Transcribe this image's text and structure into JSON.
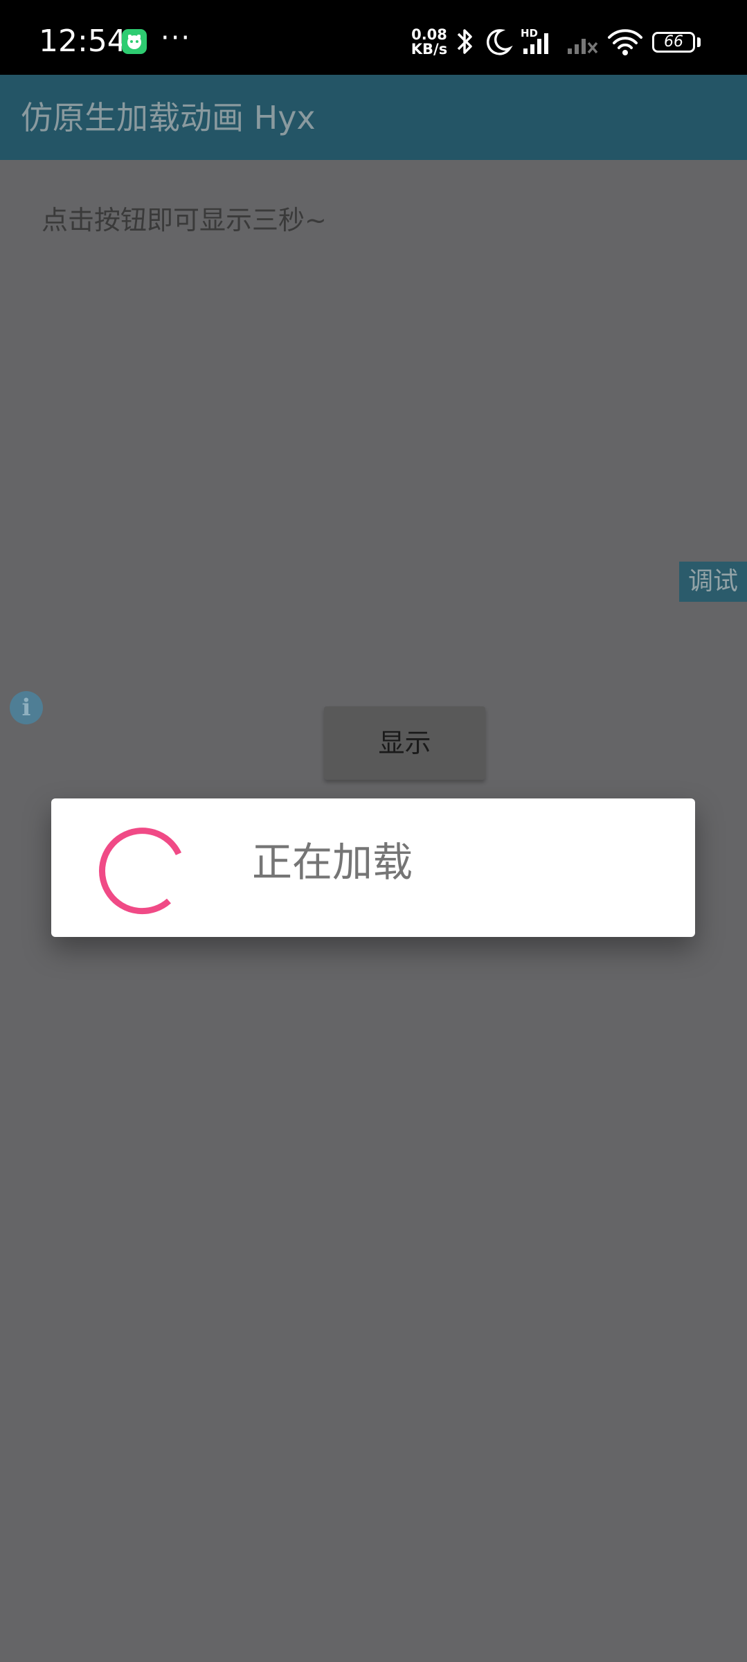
{
  "status_bar": {
    "time": "12:54",
    "more": "···",
    "net_speed_value": "0.08",
    "net_speed_unit": "KB/s",
    "hd_label": "HD",
    "battery_level": "66"
  },
  "app_bar": {
    "title": "仿原生加载动画 Hyx",
    "color": "#245566"
  },
  "content": {
    "hint": "点击按钮即可显示三秒~",
    "debug_label": "调试",
    "info_icon_glyph": "i",
    "show_button_label": "显示"
  },
  "dialog": {
    "loading_text": "正在加载",
    "spinner_color": "#f04a86"
  },
  "icons": {
    "app": "green-app-icon",
    "bluetooth": "bluetooth-icon",
    "moon": "moon-icon",
    "signal": "signal-icon",
    "signal2": "signal-no-service-icon",
    "wifi": "wifi-icon",
    "battery": "battery-icon",
    "info": "info-icon",
    "spinner": "loading-spinner-icon"
  }
}
